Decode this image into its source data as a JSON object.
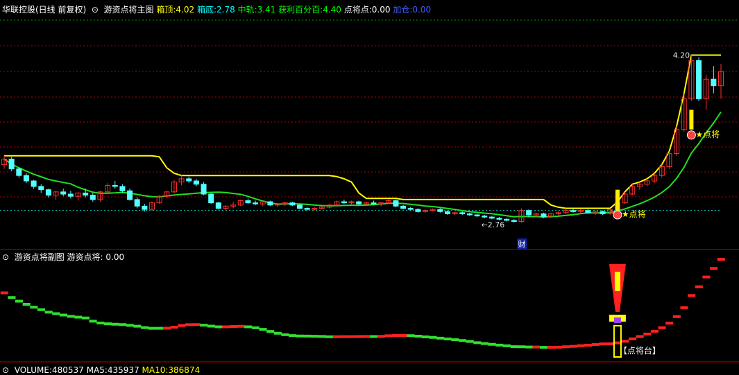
{
  "main_header": {
    "stock_name": "华联控股(日线 前复权)",
    "indicator_name": "游资点将主图",
    "box_top_label": "箱顶:",
    "box_top_value": "4.02",
    "box_bottom_label": "箱底:",
    "box_bottom_value": "2.78",
    "mid_label": "中轨:",
    "mid_value": "3.41",
    "profit_label": "获利百分百:",
    "profit_value": "4.40",
    "point_label": "点将点:",
    "point_value": "0.00",
    "extra_label": "加仓:",
    "extra_value": "0.00"
  },
  "sub_header": {
    "indicator_name": "游资点将副图",
    "value_label": "游资点将:",
    "value": "0.00"
  },
  "volume_header": {
    "volume_label": "VOLUME:",
    "volume_value": "480537",
    "ma5_label": "MA5:",
    "ma5_value": "435937",
    "ma10_label": "MA10:",
    "ma10_value": "386874"
  },
  "annotations": {
    "high_label": "4.20",
    "low_label": "2.76",
    "signal_label_1": "点将",
    "signal_label_2": "点将",
    "finance_marker": "财",
    "platform_label": "【点将台】"
  },
  "colors": {
    "up": "#ff3030",
    "down": "#54ffff",
    "ma_yellow": "#ffff00",
    "ma_green": "#20e020",
    "grid": "#b00000",
    "dotted": "#00c0c0"
  },
  "chart_data": {
    "type": "candlestick",
    "ohlc": [
      [
        3.2,
        3.28,
        3.16,
        3.25
      ],
      [
        3.25,
        3.27,
        3.14,
        3.16
      ],
      [
        3.16,
        3.17,
        3.08,
        3.1
      ],
      [
        3.1,
        3.12,
        3.03,
        3.05
      ],
      [
        3.05,
        3.06,
        2.98,
        3.0
      ],
      [
        3.0,
        3.02,
        2.94,
        2.97
      ],
      [
        2.97,
        2.98,
        2.9,
        2.92
      ],
      [
        2.92,
        2.96,
        2.88,
        2.95
      ],
      [
        2.95,
        2.98,
        2.91,
        2.93
      ],
      [
        2.93,
        2.96,
        2.89,
        2.91
      ],
      [
        2.91,
        2.95,
        2.87,
        2.94
      ],
      [
        2.94,
        2.98,
        2.9,
        2.92
      ],
      [
        2.92,
        2.94,
        2.86,
        2.88
      ],
      [
        2.88,
        2.96,
        2.86,
        2.95
      ],
      [
        2.95,
        3.03,
        2.93,
        3.01
      ],
      [
        3.01,
        3.05,
        2.98,
        3.0
      ],
      [
        3.0,
        3.02,
        2.94,
        2.96
      ],
      [
        2.96,
        2.98,
        2.87,
        2.88
      ],
      [
        2.88,
        2.9,
        2.8,
        2.82
      ],
      [
        2.82,
        2.84,
        2.77,
        2.79
      ],
      [
        2.79,
        2.86,
        2.78,
        2.85
      ],
      [
        2.85,
        2.92,
        2.84,
        2.91
      ],
      [
        2.91,
        2.96,
        2.89,
        2.95
      ],
      [
        2.95,
        3.06,
        2.94,
        3.04
      ],
      [
        3.04,
        3.1,
        3.01,
        3.07
      ],
      [
        3.07,
        3.09,
        3.03,
        3.05
      ],
      [
        3.05,
        3.07,
        3.0,
        3.02
      ],
      [
        3.02,
        3.04,
        2.92,
        2.93
      ],
      [
        2.93,
        2.94,
        2.84,
        2.85
      ],
      [
        2.85,
        2.86,
        2.79,
        2.8
      ],
      [
        2.8,
        2.83,
        2.78,
        2.82
      ],
      [
        2.82,
        2.86,
        2.8,
        2.83
      ],
      [
        2.83,
        2.88,
        2.82,
        2.87
      ],
      [
        2.87,
        2.89,
        2.84,
        2.85
      ],
      [
        2.85,
        2.87,
        2.83,
        2.84
      ],
      [
        2.84,
        2.87,
        2.82,
        2.86
      ],
      [
        2.86,
        2.87,
        2.82,
        2.83
      ],
      [
        2.83,
        2.85,
        2.81,
        2.84
      ],
      [
        2.84,
        2.86,
        2.82,
        2.85
      ],
      [
        2.85,
        2.86,
        2.82,
        2.83
      ],
      [
        2.83,
        2.84,
        2.79,
        2.8
      ],
      [
        2.8,
        2.81,
        2.78,
        2.79
      ],
      [
        2.79,
        2.81,
        2.78,
        2.8
      ],
      [
        2.8,
        2.82,
        2.79,
        2.81
      ],
      [
        2.81,
        2.84,
        2.8,
        2.83
      ],
      [
        2.83,
        2.87,
        2.82,
        2.86
      ],
      [
        2.86,
        2.88,
        2.84,
        2.85
      ],
      [
        2.85,
        2.87,
        2.83,
        2.86
      ],
      [
        2.86,
        2.87,
        2.83,
        2.84
      ],
      [
        2.84,
        2.86,
        2.82,
        2.85
      ],
      [
        2.85,
        2.87,
        2.83,
        2.84
      ],
      [
        2.84,
        2.86,
        2.82,
        2.85
      ],
      [
        2.85,
        2.88,
        2.84,
        2.87
      ],
      [
        2.87,
        2.88,
        2.81,
        2.82
      ],
      [
        2.82,
        2.83,
        2.79,
        2.8
      ],
      [
        2.8,
        2.81,
        2.78,
        2.79
      ],
      [
        2.79,
        2.8,
        2.76,
        2.77
      ],
      [
        2.77,
        2.79,
        2.76,
        2.78
      ],
      [
        2.78,
        2.8,
        2.77,
        2.79
      ],
      [
        2.79,
        2.8,
        2.76,
        2.77
      ],
      [
        2.77,
        2.78,
        2.74,
        2.75
      ],
      [
        2.75,
        2.77,
        2.74,
        2.76
      ],
      [
        2.76,
        2.77,
        2.74,
        2.75
      ],
      [
        2.75,
        2.76,
        2.73,
        2.74
      ],
      [
        2.74,
        2.75,
        2.72,
        2.73
      ],
      [
        2.73,
        2.74,
        2.71,
        2.72
      ],
      [
        2.72,
        2.73,
        2.7,
        2.71
      ],
      [
        2.71,
        2.72,
        2.69,
        2.7
      ],
      [
        2.7,
        2.71,
        2.68,
        2.69
      ],
      [
        2.69,
        2.7,
        2.67,
        2.68
      ],
      [
        2.68,
        2.8,
        2.67,
        2.78
      ],
      [
        2.78,
        2.79,
        2.72,
        2.74
      ],
      [
        2.74,
        2.76,
        2.72,
        2.75
      ],
      [
        2.75,
        2.76,
        2.71,
        2.72
      ],
      [
        2.72,
        2.76,
        2.71,
        2.75
      ],
      [
        2.75,
        2.77,
        2.73,
        2.76
      ],
      [
        2.76,
        2.8,
        2.75,
        2.78
      ],
      [
        2.78,
        2.8,
        2.76,
        2.77
      ],
      [
        2.77,
        2.79,
        2.75,
        2.78
      ],
      [
        2.78,
        2.79,
        2.75,
        2.76
      ],
      [
        2.76,
        2.78,
        2.74,
        2.77
      ],
      [
        2.77,
        2.78,
        2.74,
        2.75
      ],
      [
        2.75,
        2.8,
        2.74,
        2.79
      ],
      [
        2.79,
        2.86,
        2.78,
        2.85
      ],
      [
        2.85,
        2.95,
        2.84,
        2.93
      ],
      [
        2.93,
        3.02,
        2.92,
        3.0
      ],
      [
        3.0,
        3.04,
        2.97,
        3.02
      ],
      [
        3.02,
        3.07,
        3.0,
        3.05
      ],
      [
        3.05,
        3.12,
        3.03,
        3.1
      ],
      [
        3.1,
        3.2,
        3.08,
        3.18
      ],
      [
        3.18,
        3.32,
        3.16,
        3.3
      ],
      [
        3.3,
        3.55,
        3.28,
        3.52
      ],
      [
        3.52,
        3.85,
        3.5,
        3.8
      ],
      [
        3.8,
        4.2,
        3.78,
        4.15
      ],
      [
        4.15,
        4.18,
        3.78,
        3.8
      ],
      [
        3.8,
        4.02,
        3.7,
        3.98
      ],
      [
        3.98,
        4.1,
        3.85,
        3.92
      ],
      [
        3.92,
        4.12,
        3.8,
        4.05
      ]
    ],
    "box_top_line": 4.02,
    "box_bottom_line": 2.78,
    "ylim": [
      2.55,
      4.45
    ]
  }
}
